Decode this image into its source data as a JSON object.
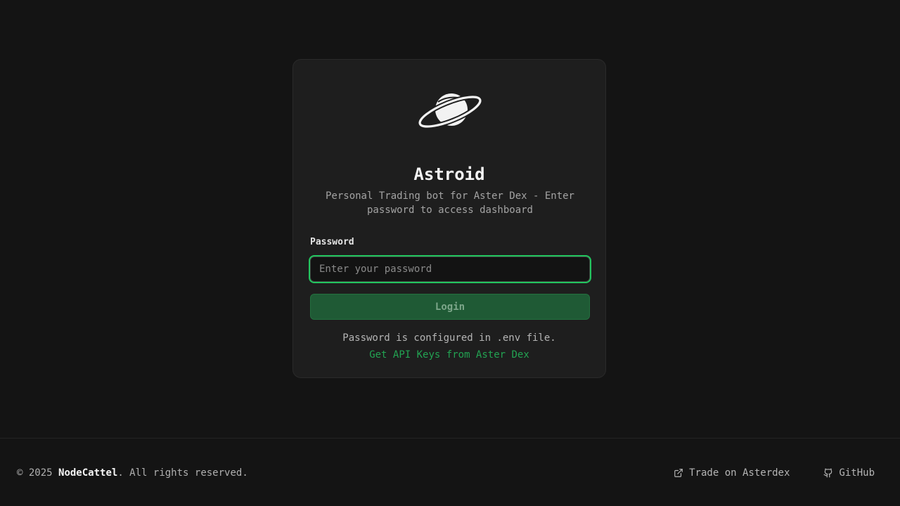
{
  "login": {
    "title": "Astroid",
    "subtitle": "Personal Trading bot for Aster Dex - Enter password to access dashboard",
    "password_label": "Password",
    "password_placeholder": "Enter your password",
    "password_value": "",
    "login_button": "Login",
    "note": "Password is configured in .env file.",
    "api_link": "Get API Keys from Aster Dex"
  },
  "footer": {
    "copyright_prefix": "© 2025 ",
    "brand": "NodeCattel",
    "copyright_suffix": ". All rights reserved.",
    "links": [
      {
        "label": "Trade on Asterdex",
        "icon": "external-link-icon"
      },
      {
        "label": "GitHub",
        "icon": "github-icon"
      }
    ]
  },
  "colors": {
    "background": "#141414",
    "card": "#1e1e1e",
    "accent": "#22c55e",
    "button": "#1f5a35"
  },
  "icons": {
    "logo": "planet-logo-icon"
  }
}
